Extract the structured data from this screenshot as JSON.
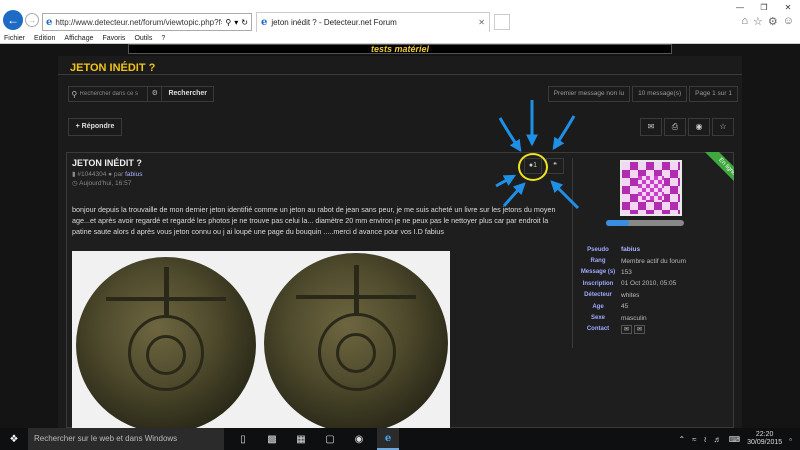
{
  "browser": {
    "url": "http://www.detecteur.net/forum/viewtopic.php?f=11!",
    "tab_title": "jeton inédit ? - Detecteur.net Forum",
    "menu": [
      "Fichier",
      "Edition",
      "Affichage",
      "Favoris",
      "Outils",
      "?"
    ]
  },
  "banner_text": "tests matériel",
  "page_title": "JETON INÉDIT ?",
  "search": {
    "placeholder": "Rechercher dans ce s",
    "button": "Rechercher"
  },
  "pager": [
    "Premier message non lu",
    "10 message(s)",
    "Page 1 sur 1"
  ],
  "reply_label": "+ Répondre",
  "post": {
    "title": "JETON INÉDIT ?",
    "id": "#1044304",
    "par": "par",
    "author": "fabius",
    "date": "Aujourd'hui, 16:57",
    "like_count": "1",
    "body": "bonjour depuis la trouvaille de mon dernier jeton identifié comme un jeton au rabot de jean sans peur, je me suis acheté un livre sur les jetons du moyen age...et après avoir regardé et regardé les photos je ne trouve pas celui la... diamètre 20 mm environ je ne peux pas le nettoyer plus car par endroit la patine saute alors d après vous jeton connu ou j ai loupé une page du bouquin .....merci d avance pour vos I.D fabius"
  },
  "online_badge": "En ligne",
  "reputation_fraction": 0.3,
  "profile": [
    {
      "k": "Pseudo",
      "v": "fabius"
    },
    {
      "k": "Rang",
      "v": "Membre actif du forum"
    },
    {
      "k": "Message (s)",
      "v": "153"
    },
    {
      "k": "Inscription",
      "v": "01 Oct 2010, 05:05"
    },
    {
      "k": "Détecteur",
      "v": "whites"
    },
    {
      "k": "Age",
      "v": "45"
    },
    {
      "k": "Sexe",
      "v": "masculin"
    }
  ],
  "contact_label": "Contact",
  "taskbar": {
    "search_placeholder": "Rechercher sur le web et dans Windows",
    "time": "22:20",
    "date": "30/09/2015"
  },
  "colors": {
    "accent": "#f0c419",
    "annotation_arrow": "#1e90e6",
    "annotation_circle": "#f2e21f"
  }
}
